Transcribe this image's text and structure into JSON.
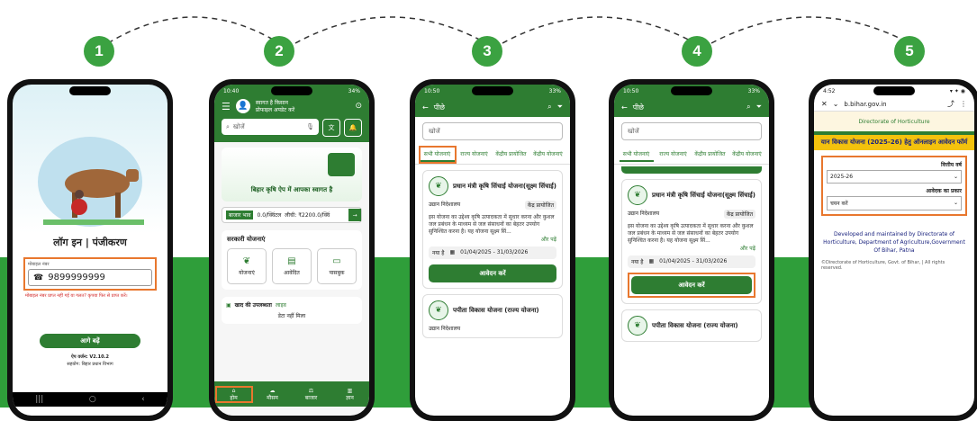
{
  "steps": [
    "1",
    "2",
    "3",
    "4",
    "5"
  ],
  "phone1": {
    "title": "लॉग इन | पंजीकरण",
    "mobile_label": "मोबाइल नंबर",
    "mobile_value": "9899999999",
    "helper": "मोबाइल नंबर प्राप्त नहीं गई या गलत? कृपया फिर से प्राप्त करें।",
    "button": "आगे बढ़ें",
    "version": "ऐप वर्जन: V2.10.2",
    "footer": "सहयोग: बिहार प्रधान विभाग"
  },
  "phone2": {
    "time": "10:40",
    "battery": "34%",
    "greeting": "स्वागत है किसान",
    "subtitle": "प्रोफाइल अपडेट करें",
    "search_placeholder": "खोजें",
    "banner_text": "बिहार कृषि ऐप में आपका स्वागत है",
    "ticker_label": "बाजार भाव",
    "ticker_1": "0.0/क्विंटल",
    "ticker_2": "लीची: ₹2200.0/क्विं",
    "section_title": "सरकारी योजनाएं",
    "tiles": [
      "योजनाएं",
      "आवेदित",
      "पासबुक"
    ],
    "fert_title": "खाद की उपलब्धता",
    "fert_badge": "लाइव",
    "fert_sub": "डेटा नहीं मिला",
    "nav": [
      "होम",
      "मौसम",
      "बाजार",
      "ज्ञान"
    ]
  },
  "phone3": {
    "time": "10:50",
    "battery": "33%",
    "back": "पीछे",
    "search": "खोजें",
    "tabs": [
      "सभी योजनाएं",
      "राज्य योजनाएं",
      "केंद्रीय प्रायोजित",
      "केंद्रीय योजनाएं"
    ],
    "card1_title": "प्रधान मंत्री कृषि सिंचाई योजना(सूक्ष्म सिंचाई)",
    "card1_dept": "उद्यान निदेशालय",
    "card1_badge": "केंद्र प्रायोजित",
    "card1_desc": "इस योजना का उद्देश्य कृषि उत्पादकता में सुधार करना और कुशल जल प्रबंधन के माध्यम से जल संसाधनों का बेहतर उपयोग सुनिश्चित करना है। यह योजना सूक्ष्म सिं...",
    "more": "और पढ़ें",
    "card1_tag": "नया है",
    "card1_dates": "01/04/2025 - 31/03/2026",
    "apply": "आवेदन करें",
    "card2_title": "पपीता विकास योजना (राज्य योजना)",
    "card2_dept": "उद्यान निदेशालय"
  },
  "phone4": {
    "time": "10:50",
    "battery": "33%",
    "back": "पीछे",
    "search": "खोजें",
    "tabs": [
      "सभी योजनाएं",
      "राज्य योजनाएं",
      "केंद्रीय प्रायोजित",
      "केंद्रीय योजनाएं"
    ],
    "card1_title": "प्रधान मंत्री कृषि सिंचाई योजना(सूक्ष्म सिंचाई)",
    "card1_dept": "उद्यान निदेशालय",
    "card1_badge": "केंद्र प्रायोजित",
    "card1_desc": "इस योजना का उद्देश्य कृषि उत्पादकता में सुधार करना और कुशल जल प्रबंधन के माध्यम से जल संसाधनों का बेहतर उपयोग सुनिश्चित करना है। यह योजना सूक्ष्म सिं...",
    "more": "और पढ़ें",
    "card1_tag": "नया है",
    "card1_dates": "01/04/2025 - 31/03/2026",
    "apply": "आवेदन करें",
    "card2_title": "पपीता विकास योजना (राज्य योजना)"
  },
  "phone5": {
    "time": "4:52",
    "url": "b.bihar.gov.in",
    "site_header": "Directorate of Horticulture",
    "form_title": "यान विकास योजना (2025-26) हेतु ऑनलाइन आवेदन फॉर्म",
    "fy_label": "वित्तीय वर्ष",
    "fy_value": "2025-26",
    "type_label": "आवेदक का प्रकार",
    "type_value": "चयन करें",
    "dev_text": "Developed and maintained by Directorate of Horticulture, Department of Agriculture,Government Of Bihar, Patna",
    "copyright": "©Directorate of Horticulture, Govt. of Bihar, | All rights reserved."
  }
}
